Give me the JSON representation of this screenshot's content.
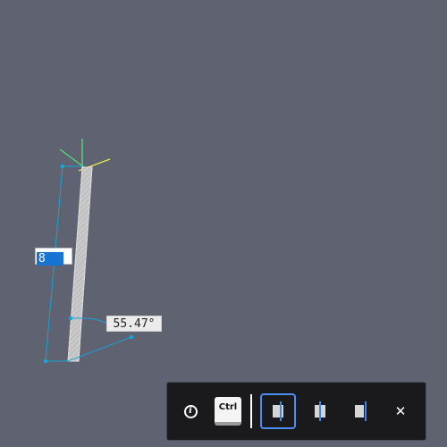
{
  "viewport": {
    "length_input_value": "8",
    "angle_readout": "55.47°"
  },
  "toolbar": {
    "info_icon": "info-icon",
    "ctrl_key_label": "Ctrl",
    "align_options": [
      "align-left-icon",
      "align-center-icon",
      "align-right-icon"
    ],
    "selected_align": "align-left-icon",
    "close_icon": "close-icon"
  },
  "colors": {
    "background": "#5f6270",
    "dimension_lines": "#19a3d6",
    "wall_fill": "#c9c9c9",
    "selection_blue": "#1874d2",
    "toolbar_bg": "#1a1a1d",
    "active_border": "#4a8ff0",
    "axis_green": "#52e07a",
    "axis_yellow": "#e8e85a"
  }
}
